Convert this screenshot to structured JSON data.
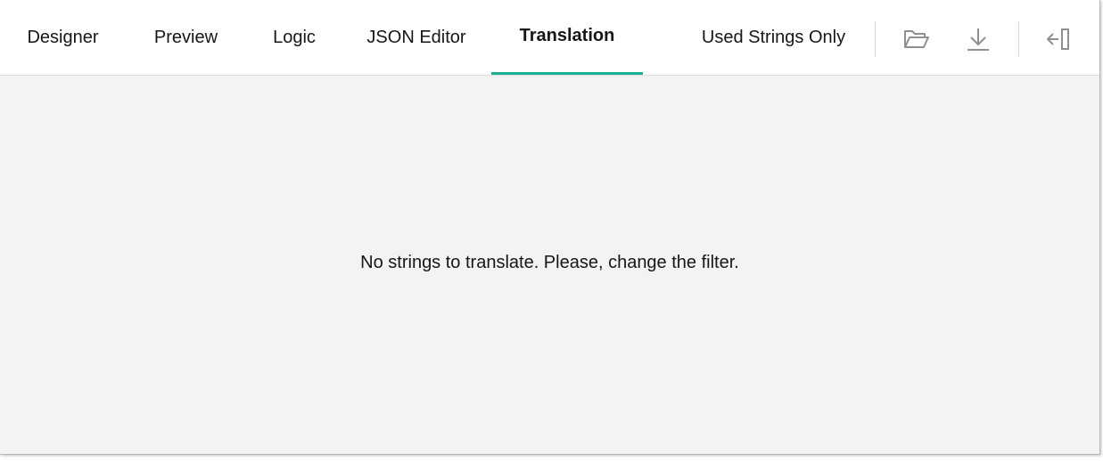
{
  "tabs": [
    {
      "label": "Designer",
      "active": false
    },
    {
      "label": "Preview",
      "active": false
    },
    {
      "label": "Logic",
      "active": false
    },
    {
      "label": "JSON Editor",
      "active": false
    },
    {
      "label": "Translation",
      "active": true
    }
  ],
  "toolbar": {
    "filter_label": "Used Strings Only",
    "icons": [
      "open-folder-icon",
      "download-icon",
      "collapse-panel-icon"
    ]
  },
  "content": {
    "empty_message": "No strings to translate. Please, change the filter."
  },
  "colors": {
    "accent": "#19b394",
    "background": "#f3f3f3",
    "tabbar_background": "#ffffff",
    "text": "#161616",
    "icon": "#909090"
  }
}
